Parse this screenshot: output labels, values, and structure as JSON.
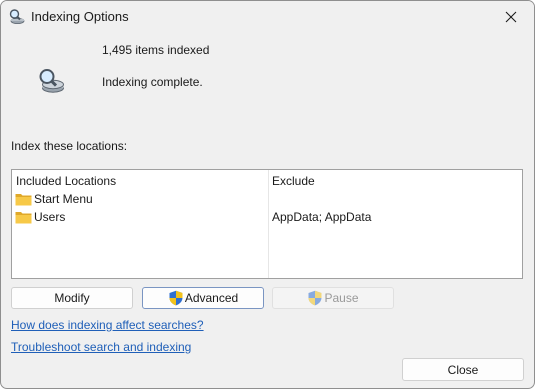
{
  "window": {
    "title": "Indexing Options",
    "icon": "magnifier-drive-icon",
    "close_label": "Close window"
  },
  "status": {
    "count_text": "1,495 items indexed",
    "status_text": "Indexing complete.",
    "icon": "magnifier-drive-icon"
  },
  "locations": {
    "section_label": "Index these locations:",
    "headers": {
      "included": "Included Locations",
      "exclude": "Exclude"
    },
    "rows": [
      {
        "name": "Start Menu",
        "exclude": "",
        "icon": "folder-icon"
      },
      {
        "name": "Users",
        "exclude": "AppData; AppData",
        "icon": "folder-icon"
      }
    ]
  },
  "buttons": {
    "modify": "Modify",
    "advanced": "Advanced",
    "pause": "Pause",
    "close": "Close"
  },
  "links": {
    "how_indexing": "How does indexing affect searches?",
    "troubleshoot": "Troubleshoot search and indexing"
  },
  "colors": {
    "window_bg": "#f0f0f0",
    "link": "#1f5fb8",
    "disabled_text": "#9a9a9a",
    "shield_blue": "#2f6fd1",
    "shield_yellow": "#f2c21b",
    "folder_yellow": "#f7c948"
  }
}
